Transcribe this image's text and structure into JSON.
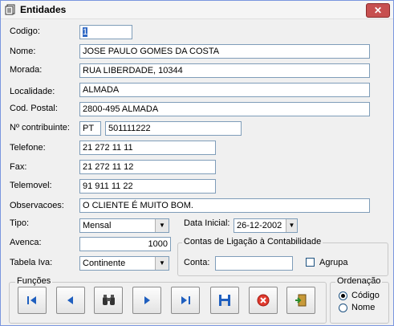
{
  "window": {
    "title": "Entidades",
    "close_label": "✕"
  },
  "fields": {
    "codigo": {
      "label": "Codigo:",
      "value": "1"
    },
    "nome": {
      "label": "Nome:",
      "value": "JOSE PAULO GOMES DA COSTA"
    },
    "morada": {
      "label": "Morada:",
      "value": "RUA LIBERDADE, 10344"
    },
    "localidade": {
      "label": "Localidade:",
      "value": "ALMADA"
    },
    "cod_postal": {
      "label": "Cod. Postal:",
      "value": "2800-495 ALMADA"
    },
    "contribuinte": {
      "label": "Nº contribuinte:",
      "prefix": "PT",
      "value": "501111222"
    },
    "telefone": {
      "label": "Telefone:",
      "value": "21 272 11 11"
    },
    "fax": {
      "label": "Fax:",
      "value": "21 272 11 12"
    },
    "telemovel": {
      "label": "Telemovel:",
      "value": "91 911 11 22"
    },
    "observacoes": {
      "label": "Observacoes:",
      "value": "O CLIENTE É MUITO BOM."
    },
    "tipo": {
      "label": "Tipo:",
      "value": "Mensal"
    },
    "data_inicial": {
      "label": "Data Inicial:",
      "value": "26-12-2002"
    },
    "avenca": {
      "label": "Avenca:",
      "value": "1000"
    },
    "tabela_iva": {
      "label": "Tabela Iva:",
      "value": "Continente"
    }
  },
  "contas": {
    "group_title": "Contas de Ligação à Contabilidade",
    "conta_label": "Conta:",
    "conta_value": "",
    "agrupa_label": "Agrupa",
    "agrupa_checked": false
  },
  "funcoes": {
    "group_title": "Funções"
  },
  "ordenacao": {
    "group_title": "Ordenação",
    "options": [
      "Código",
      "Nome"
    ],
    "selected": "Código"
  }
}
